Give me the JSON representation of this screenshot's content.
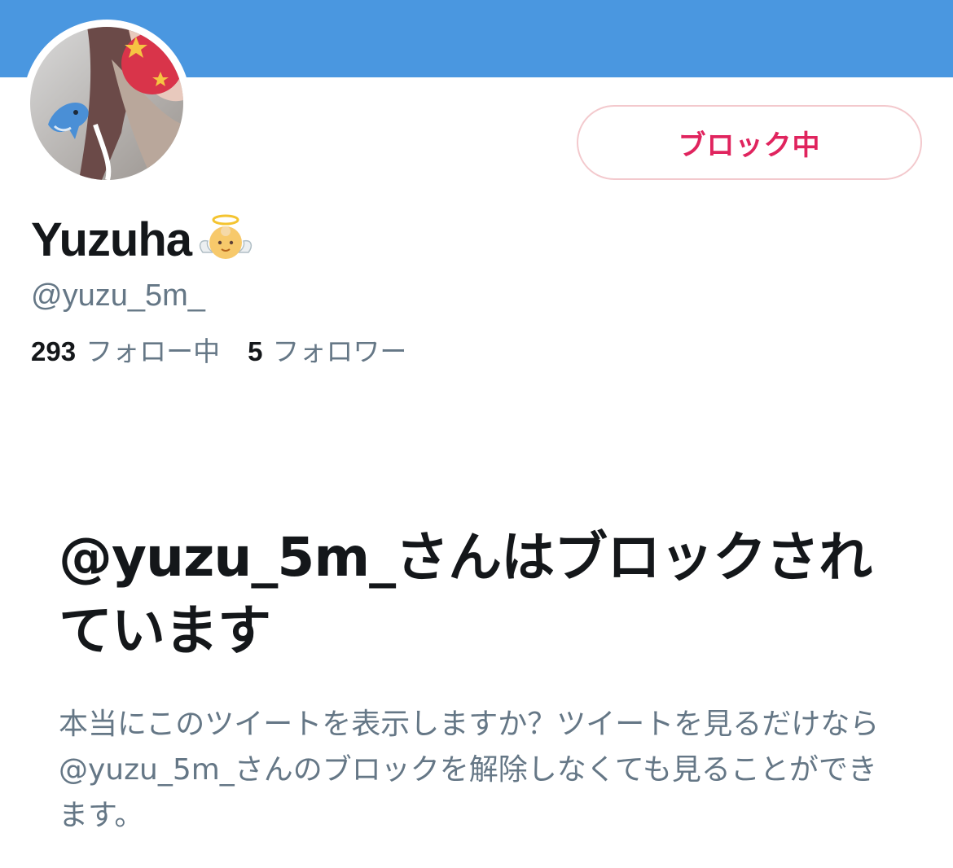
{
  "colors": {
    "banner": "#4a97e0",
    "block_button_text": "#e0245e",
    "block_button_border": "#f3c9cd",
    "primary_text": "#14171a",
    "secondary_text": "#657786"
  },
  "profile": {
    "display_name": "Yuzuha",
    "name_emoji": "angel-emoji-icon",
    "handle": "@yuzu_5m_",
    "following_count": "293",
    "following_label": "フォロー中",
    "followers_count": "5",
    "followers_label": "フォロワー"
  },
  "actions": {
    "block_button_label": "ブロック中"
  },
  "blocked_notice": {
    "heading": "@yuzu_5m_さんはブロックされています",
    "body": "本当にこのツイートを表示しますか？ツイートを見るだけなら @yuzu_5m_さんのブロックを解除しなくても見ることができます。"
  }
}
